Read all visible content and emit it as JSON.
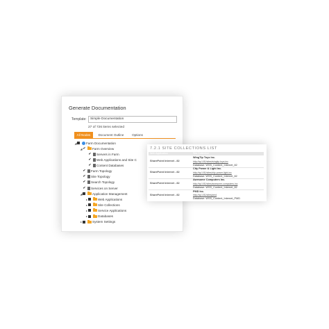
{
  "dialog": {
    "title": "Generate Documentation",
    "template_label": "Template:",
    "template_value": "Simple Documentation",
    "selection_count": "27 of 726 items selected",
    "tabs": [
      {
        "label": "All Nodes",
        "active": true
      },
      {
        "label": "Document Outline",
        "active": false
      },
      {
        "label": "Options",
        "active": false
      }
    ],
    "tree": [
      {
        "label": "Farm Documentation",
        "icon": "globe-icon",
        "toggle": "expanded",
        "check": "partial",
        "level": 0
      },
      {
        "label": "Farm Overview",
        "icon": "folder-icon",
        "toggle": "expanded",
        "check": "checked",
        "level": 1
      },
      {
        "label": "Servers in Farm",
        "icon": "document-icon",
        "toggle": "",
        "check": "checked",
        "level": 2
      },
      {
        "label": "Web Applications and Site C",
        "icon": "document-icon",
        "toggle": "",
        "check": "checked",
        "level": 2
      },
      {
        "label": "Content Databases",
        "icon": "document-icon",
        "toggle": "",
        "check": "checked",
        "level": 2
      },
      {
        "label": "Farm Topology",
        "icon": "document-icon",
        "toggle": "",
        "check": "checked",
        "level": 1
      },
      {
        "label": "Site Topology",
        "icon": "document-icon",
        "toggle": "",
        "check": "checked",
        "level": 1
      },
      {
        "label": "Search Topology",
        "icon": "document-icon",
        "toggle": "",
        "check": "checked",
        "level": 1
      },
      {
        "label": "Services on Server",
        "icon": "document-icon",
        "toggle": "",
        "check": "checked",
        "level": 1
      },
      {
        "label": "Application Management",
        "icon": "folder-icon",
        "toggle": "expanded",
        "check": "partial",
        "level": 1
      },
      {
        "label": "Web Applications",
        "icon": "folder-icon",
        "toggle": "collapsed",
        "check": "partial",
        "level": 2
      },
      {
        "label": "Site Collections",
        "icon": "folder-icon",
        "toggle": "collapsed",
        "check": "partial",
        "level": 2
      },
      {
        "label": "Service Applications",
        "icon": "folder-icon",
        "toggle": "collapsed",
        "check": "partial",
        "level": 2
      },
      {
        "label": "Databases",
        "icon": "folder-icon",
        "toggle": "collapsed",
        "check": "partial",
        "level": 2
      },
      {
        "label": "System Settings",
        "icon": "folder-icon",
        "toggle": "collapsed",
        "check": "partial",
        "level": 1
      }
    ]
  },
  "popup": {
    "heading": "7.2.1   SITE COLLECTIONS LIST",
    "columns": [
      "Web Application",
      "Site Collection"
    ],
    "rows": [
      {
        "type": "SharePoint Internet - 82",
        "name": "WingTip Toys Inc.",
        "url": "http://sp1:81/sites/wingtip-toys-inc",
        "db": "Database: WSS_Content_Internet_82"
      },
      {
        "type": "SharePoint Internet - 82",
        "name": "City Power & Light Inc.",
        "url": "http://sp1:81/sites/city-power-light-inc",
        "db": "Database: WSS_Content_Internet_82"
      },
      {
        "type": "SharePoint Internet - 82",
        "name": "Awesome Computers Inc.",
        "url": "http://sp1:81/sites/awesome-computers-inc",
        "db": "Database: WSS_Content_Internet_82"
      },
      {
        "type": "SharePoint Internet - 82",
        "name": "PMD Inc.",
        "url": "http://sp1:81/sites/pmd",
        "db": "Database: WSS_Content_Internet_PMD"
      }
    ]
  },
  "colors": {
    "accent": "#f0901e",
    "folder": "#f5a623",
    "globe": "#3a8ee6"
  }
}
